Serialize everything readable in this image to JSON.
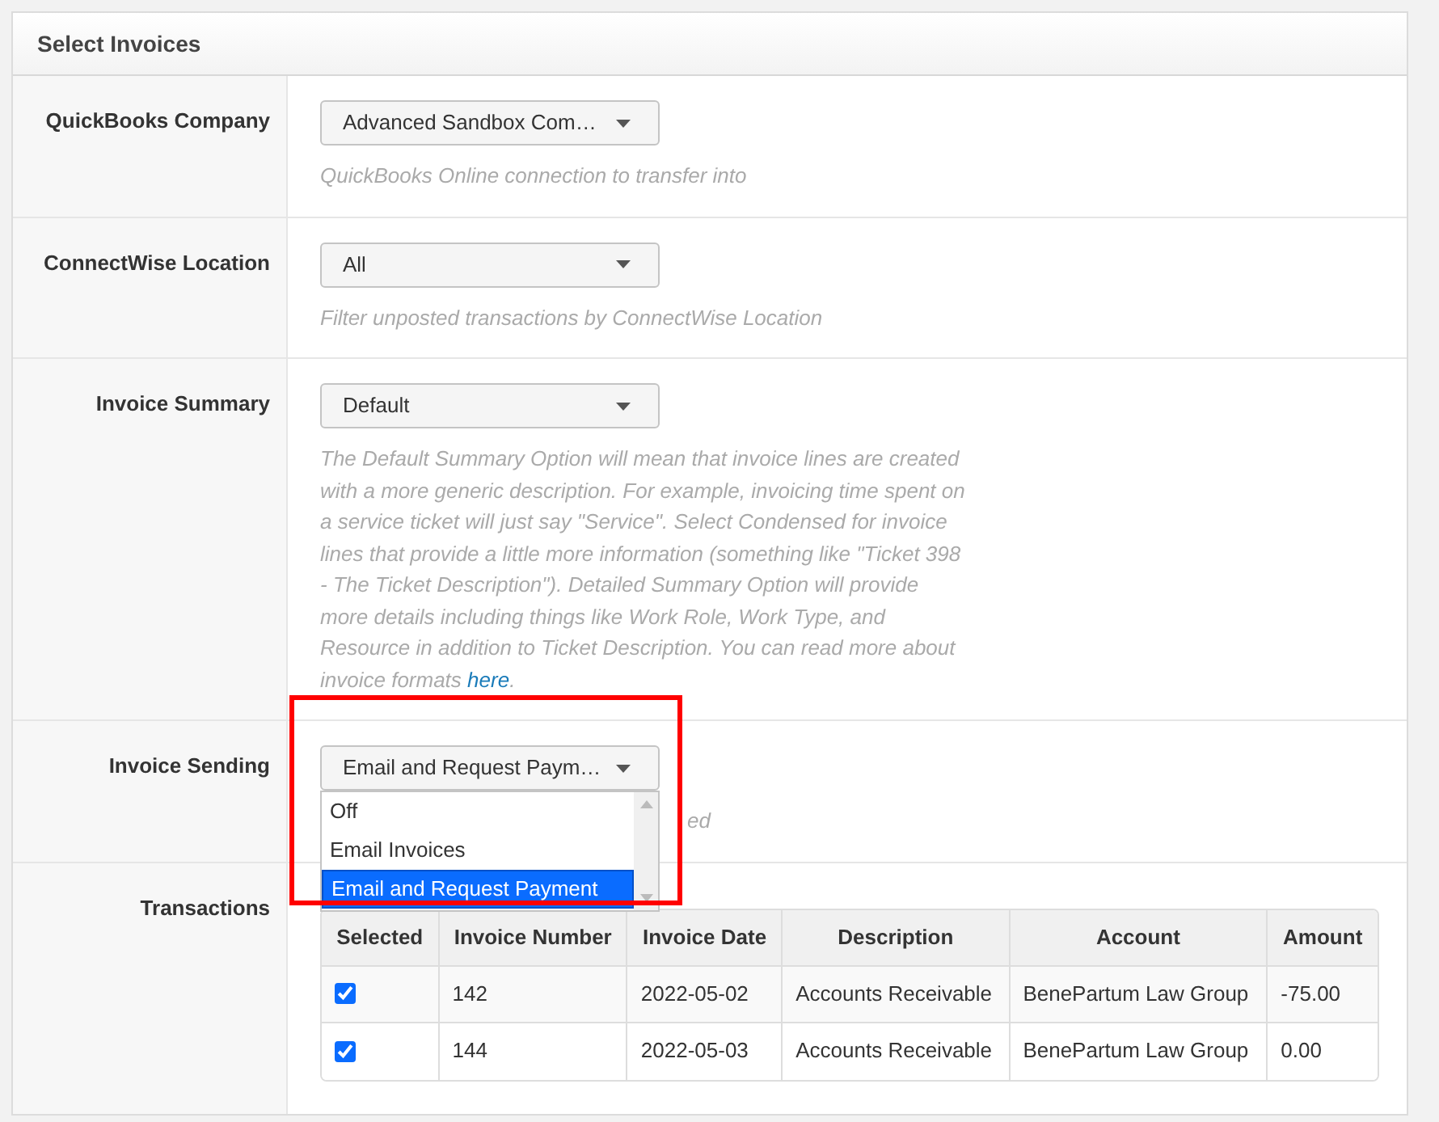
{
  "panel": {
    "title": "Select Invoices"
  },
  "fields": [
    {
      "kind": "select",
      "label": "QuickBooks Company",
      "value": "Advanced Sandbox Com…",
      "hint": "QuickBooks Online connection to transfer into"
    },
    {
      "kind": "select",
      "label": "ConnectWise Location",
      "value": "All",
      "hint": "Filter unposted transactions by ConnectWise Location"
    },
    {
      "kind": "select",
      "label": "Invoice Summary",
      "value": "Default",
      "hint": "The Default Summary Option will mean that invoice lines are created with a more generic description. For example, invoicing time spent on a service ticket will just say \"Service\". Select Condensed for invoice lines that provide a little more information (something like \"Ticket 398 - The Ticket Description\"). Detailed Summary Option will provide more details including things like Work Role, Work Type, and Resource in addition to Ticket Description. You can read more about invoice formats ",
      "link": "here",
      "hint_end": "."
    },
    {
      "kind": "open_select",
      "label": "Invoice Sending",
      "value": "Email and Request Paym…",
      "hint": "ed",
      "options": [
        {
          "label": "Off",
          "selected": false
        },
        {
          "label": "Email Invoices",
          "selected": false
        },
        {
          "label": "Email and Request Payment",
          "selected": true
        }
      ]
    },
    {
      "kind": "table",
      "label": "Transactions"
    }
  ],
  "table": {
    "checkbox_column": "Selected",
    "columns": [
      "Invoice Number",
      "Invoice Date",
      "Description",
      "Account",
      "Amount"
    ],
    "rows": [
      {
        "checked": true,
        "cells": [
          "142",
          "2022-05-02",
          "Accounts Receivable",
          "BenePartum Law Group",
          "-75.00"
        ]
      },
      {
        "checked": true,
        "cells": [
          "144",
          "2022-05-03",
          "Accounts Receivable",
          "BenePartum Law Group",
          "0.00"
        ]
      }
    ]
  }
}
